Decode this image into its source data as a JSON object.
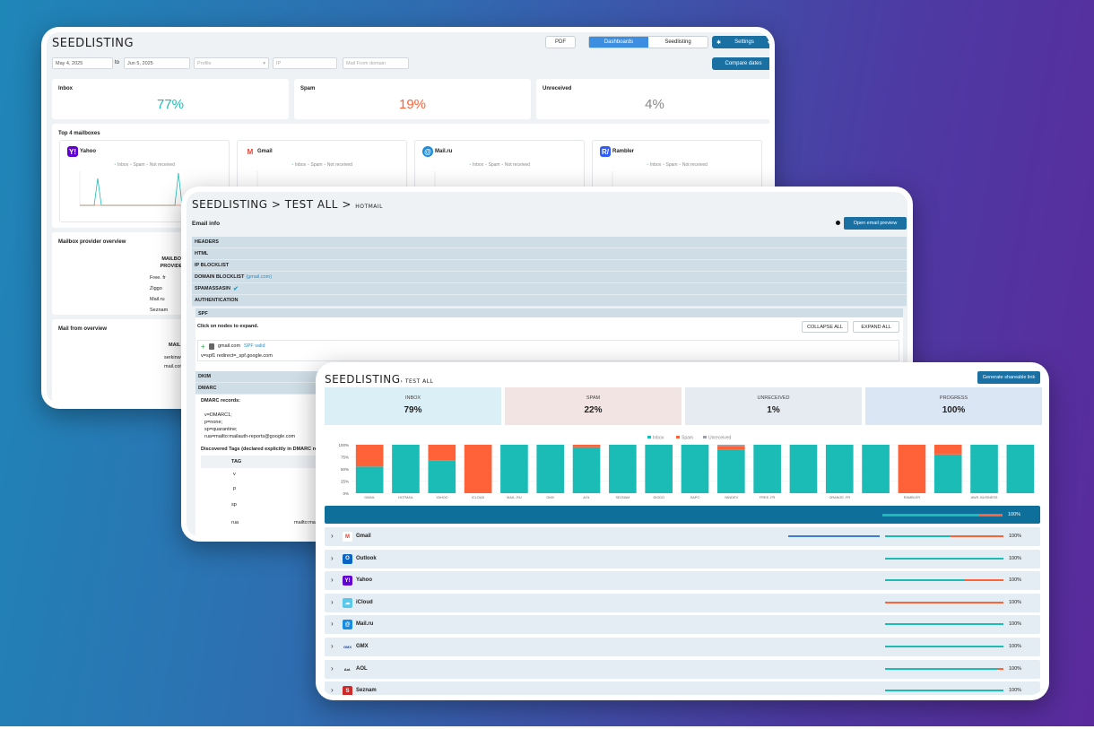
{
  "colors": {
    "inbox": "#1bbcb6",
    "spam": "#ff6138",
    "unreceived": "#9aa0a6",
    "accent": "#1a6fa3"
  },
  "dashboard": {
    "logo": "SEEDLISTING",
    "pdf": "PDF",
    "tabs": [
      "Dashboards",
      "Seedlisting"
    ],
    "settings": "Settings",
    "filters": {
      "date_from": "May 4, 2025",
      "to": "to",
      "date_to": "Jun 5, 2025",
      "profile": "Profile",
      "ip": "IP",
      "mail_from": "Mail From domain"
    },
    "compare": "Compare dates",
    "stats": [
      {
        "label": "Inbox",
        "value": "77%"
      },
      {
        "label": "Spam",
        "value": "19%"
      },
      {
        "label": "Unreceived",
        "value": "4%"
      }
    ],
    "top4_title": "Top 4 mailboxes",
    "legend": [
      "Inbox",
      "Spam",
      "Not received"
    ],
    "mailboxes": [
      {
        "name": "Yahoo",
        "icon": "yahoo-icon"
      },
      {
        "name": "Gmail",
        "icon": "gmail-icon"
      },
      {
        "name": "Mail.ru",
        "icon": "mailru-icon"
      },
      {
        "name": "Rambler",
        "icon": "rambler-icon"
      }
    ],
    "provider_title": "Mailbox provider overview",
    "provider_header": "MAILBOX PROVIDER",
    "providers": [
      "Free. fr",
      "Ziggo",
      "Mail.ru",
      "Seznam"
    ],
    "mailfrom_title": "Mail from overview",
    "mailfrom_header": "MAIL F",
    "mailfrom_rows": [
      "serkinwo",
      "mail.com"
    ]
  },
  "detail": {
    "crumb1": "SEEDLISTING",
    "sep": ">",
    "crumb2": "TEST ALL",
    "crumb3": "HOTMAIL",
    "email_info": "Email info",
    "open_preview": "Open email preview",
    "sections": [
      "HEADERS",
      "HTML",
      "IP BLOCKLIST",
      "DOMAIN BLOCKLIST",
      "SPAMASSASIN",
      "AUTHENTICATION"
    ],
    "domain_note": "(gmail.com)",
    "spf": "SPF",
    "click_nodes": "Click on nodes to expand.",
    "collapse": "COLLAPSE ALL",
    "expand": "EXPAND ALL",
    "spf_node": "gmail.com",
    "spf_valid": "SPF valid",
    "spf_record": "v=spf1 redirect=_spf.google.com",
    "dkim": "DKIM",
    "dmarc": "DMARC",
    "dmarc_records": "DMARC records:",
    "dmarc_lines": [
      "v=DMARC1;",
      "p=none;",
      "sp=quarantine;",
      "rua=mailto:mailauth-reports@google.com"
    ],
    "discovered": "Discovered Tags (declared explicitly in DMARC rec",
    "tag_header": "TAG",
    "tags": [
      "v",
      "p",
      "sp",
      "rua"
    ],
    "rua_val": "mailto:ma"
  },
  "results": {
    "logo": "SEEDLISTING",
    "sub": "› TEST ALL",
    "share": "Generate shareable link",
    "kpis": [
      {
        "label": "INBOX",
        "value": "79%"
      },
      {
        "label": "SPAM",
        "value": "22%"
      },
      {
        "label": "UNRECEIVED",
        "value": "1%"
      },
      {
        "label": "PROGRESS",
        "value": "100%"
      }
    ],
    "progress_total": "100%",
    "providers": [
      {
        "name": "Gmail",
        "icon": "gmail-icon",
        "pct": "100%"
      },
      {
        "name": "Outlook",
        "icon": "outlook-icon",
        "pct": "100%"
      },
      {
        "name": "Yahoo",
        "icon": "yahoo-icon",
        "pct": "100%"
      },
      {
        "name": "iCloud",
        "icon": "icloud-icon",
        "pct": "100%"
      },
      {
        "name": "Mail.ru",
        "icon": "mailru-icon",
        "pct": "100%"
      },
      {
        "name": "GMX",
        "icon": "gmx-icon",
        "pct": "100%"
      },
      {
        "name": "AOL",
        "icon": "aol-icon",
        "pct": "100%"
      },
      {
        "name": "Seznam",
        "icon": "seznam-icon",
        "pct": "100%"
      }
    ]
  },
  "chart_data": {
    "type": "bar",
    "stacked": true,
    "legend": [
      "Inbox",
      "Spam",
      "Unreceived"
    ],
    "yticks": [
      "100%",
      "75%",
      "50%",
      "25%",
      "0%"
    ],
    "ylim": [
      0,
      100
    ],
    "categories": [
      "GMAIL",
      "HOTMAIL",
      "YAHOO",
      "ICLOUD",
      "MAIL..RU",
      "GMX",
      "AOL",
      "SEZNAM",
      "DIGDO",
      "SAPO",
      "YANDEX",
      "FREE..FR",
      "",
      "ORANGE..FR",
      "",
      "RAMBLER",
      "",
      "AWS..BUSINESS",
      ""
    ],
    "series": [
      {
        "name": "Inbox",
        "values": [
          55,
          100,
          67,
          0,
          100,
          100,
          95,
          100,
          100,
          100,
          90,
          100,
          100,
          100,
          100,
          0,
          80,
          100,
          100
        ]
      },
      {
        "name": "Spam",
        "values": [
          45,
          0,
          33,
          100,
          0,
          0,
          5,
          0,
          0,
          0,
          7,
          0,
          0,
          0,
          0,
          100,
          20,
          0,
          0
        ]
      },
      {
        "name": "Unreceived",
        "values": [
          0,
          0,
          0,
          0,
          0,
          0,
          0,
          0,
          0,
          0,
          3,
          0,
          0,
          0,
          0,
          0,
          0,
          0,
          0
        ]
      }
    ]
  }
}
